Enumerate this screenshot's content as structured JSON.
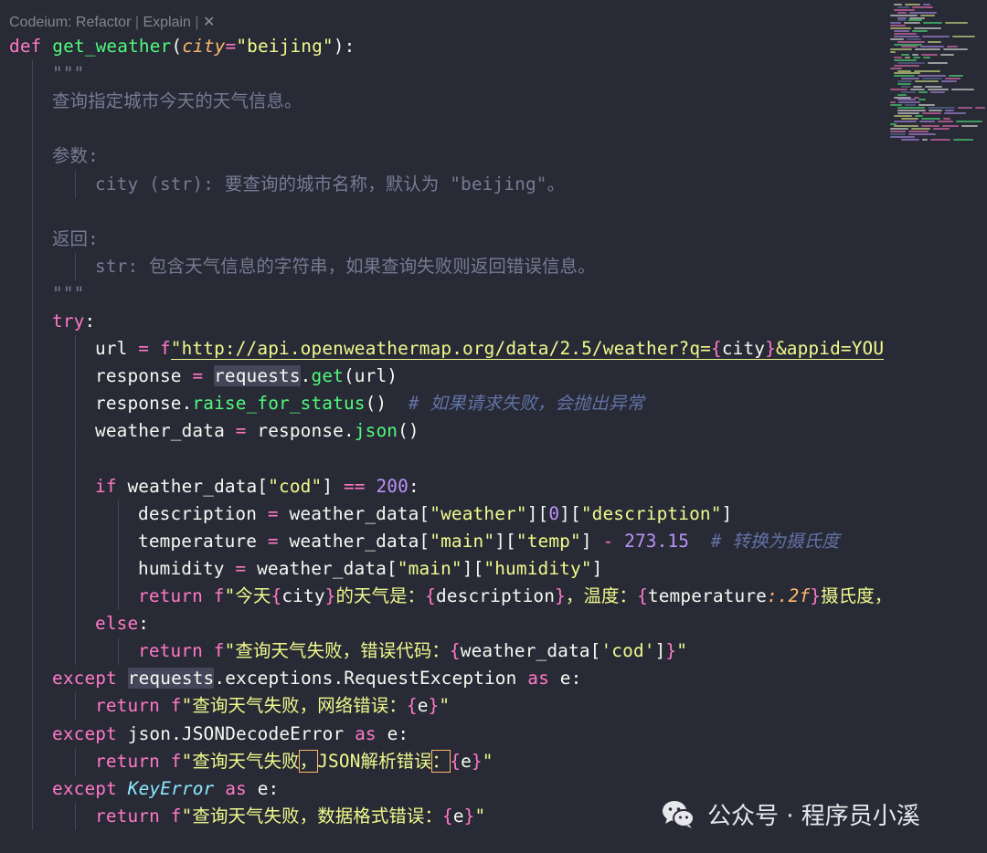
{
  "codelens": {
    "items": [
      "Codeium: Refactor",
      "Explain"
    ],
    "close_glyph": "✕"
  },
  "watermark": {
    "text": "公众号 · 程序员小溪"
  },
  "lines": [
    {
      "indent": 0,
      "tokens": [
        [
          "kw",
          "def "
        ],
        [
          "fn",
          "get_weather"
        ],
        [
          "txt",
          "("
        ],
        [
          "par",
          "city"
        ],
        [
          "op",
          "="
        ],
        [
          "str",
          "\"beijing\""
        ],
        [
          "txt",
          "):"
        ]
      ]
    },
    {
      "indent": 1,
      "tokens": [
        [
          "doc",
          "\"\"\""
        ]
      ]
    },
    {
      "indent": 1,
      "tokens": [
        [
          "doc",
          "查询指定城市今天的天气信息。"
        ]
      ]
    },
    {
      "indent": 1,
      "tokens": []
    },
    {
      "indent": 1,
      "tokens": [
        [
          "doc",
          "参数:"
        ]
      ]
    },
    {
      "indent": 2,
      "tokens": [
        [
          "doc",
          "city (str): 要查询的城市名称，默认为 \"beijing\"。"
        ]
      ]
    },
    {
      "indent": 1,
      "tokens": []
    },
    {
      "indent": 1,
      "tokens": [
        [
          "doc",
          "返回:"
        ]
      ]
    },
    {
      "indent": 2,
      "tokens": [
        [
          "doc",
          "str: 包含天气信息的字符串，如果查询失败则返回错误信息。"
        ]
      ]
    },
    {
      "indent": 1,
      "tokens": [
        [
          "doc",
          "\"\"\""
        ]
      ]
    },
    {
      "indent": 1,
      "tokens": [
        [
          "kw",
          "try"
        ],
        [
          "txt",
          ":"
        ]
      ]
    },
    {
      "indent": 2,
      "tokens": [
        [
          "txt",
          "url "
        ],
        [
          "op",
          "= "
        ],
        [
          "kw",
          "f"
        ],
        [
          "str|underline",
          "\"http://api.openweathermap.org/data/2.5/weather?q="
        ],
        [
          "br1|underline",
          "{"
        ],
        [
          "txt|underline",
          "city"
        ],
        [
          "br1|underline",
          "}"
        ],
        [
          "str|underline",
          "&appid=YOU"
        ]
      ]
    },
    {
      "indent": 2,
      "tokens": [
        [
          "txt",
          "response "
        ],
        [
          "op",
          "= "
        ],
        [
          "txt|hl",
          "requests"
        ],
        [
          "txt",
          "."
        ],
        [
          "attr",
          "get"
        ],
        [
          "txt",
          "(url)"
        ]
      ]
    },
    {
      "indent": 2,
      "tokens": [
        [
          "txt",
          "response."
        ],
        [
          "attr",
          "raise_for_status"
        ],
        [
          "txt",
          "()  "
        ],
        [
          "cmt",
          "# 如果请求失败，会抛出异常"
        ]
      ]
    },
    {
      "indent": 2,
      "tokens": [
        [
          "txt",
          "weather_data "
        ],
        [
          "op",
          "= "
        ],
        [
          "txt",
          "response."
        ],
        [
          "attr",
          "json"
        ],
        [
          "txt",
          "()"
        ]
      ]
    },
    {
      "indent": 2,
      "tokens": []
    },
    {
      "indent": 2,
      "tokens": [
        [
          "kw",
          "if "
        ],
        [
          "txt",
          "weather_data["
        ],
        [
          "str",
          "\"cod\""
        ],
        [
          "txt",
          "] "
        ],
        [
          "op",
          "== "
        ],
        [
          "num",
          "200"
        ],
        [
          "txt",
          ":"
        ]
      ]
    },
    {
      "indent": 3,
      "tokens": [
        [
          "txt",
          "description "
        ],
        [
          "op",
          "= "
        ],
        [
          "txt",
          "weather_data["
        ],
        [
          "str",
          "\"weather\""
        ],
        [
          "txt",
          "]["
        ],
        [
          "num",
          "0"
        ],
        [
          "txt",
          "]["
        ],
        [
          "str",
          "\"description\""
        ],
        [
          "txt",
          "]"
        ]
      ]
    },
    {
      "indent": 3,
      "tokens": [
        [
          "txt",
          "temperature "
        ],
        [
          "op",
          "= "
        ],
        [
          "txt",
          "weather_data["
        ],
        [
          "str",
          "\"main\""
        ],
        [
          "txt",
          "]["
        ],
        [
          "str",
          "\"temp\""
        ],
        [
          "txt",
          "] "
        ],
        [
          "op",
          "- "
        ],
        [
          "num",
          "273.15"
        ],
        [
          "txt",
          "  "
        ],
        [
          "cmt",
          "# 转换为摄氏度"
        ]
      ]
    },
    {
      "indent": 3,
      "tokens": [
        [
          "txt",
          "humidity "
        ],
        [
          "op",
          "= "
        ],
        [
          "txt",
          "weather_data["
        ],
        [
          "str",
          "\"main\""
        ],
        [
          "txt",
          "]["
        ],
        [
          "str",
          "\"humidity\""
        ],
        [
          "txt",
          "]"
        ]
      ]
    },
    {
      "indent": 3,
      "tokens": [
        [
          "kw",
          "return "
        ],
        [
          "kw",
          "f"
        ],
        [
          "str",
          "\"今天"
        ],
        [
          "br1",
          "{"
        ],
        [
          "txt",
          "city"
        ],
        [
          "br1",
          "}"
        ],
        [
          "str",
          "的天气是："
        ],
        [
          "br1",
          "{"
        ],
        [
          "txt",
          "description"
        ],
        [
          "br1",
          "}"
        ],
        [
          "str",
          "，温度："
        ],
        [
          "br1",
          "{"
        ],
        [
          "txt",
          "temperature"
        ],
        [
          "par",
          ":.2f"
        ],
        [
          "br1",
          "}"
        ],
        [
          "str",
          "摄氏度，"
        ]
      ]
    },
    {
      "indent": 2,
      "tokens": [
        [
          "kw",
          "else"
        ],
        [
          "txt",
          ":"
        ]
      ]
    },
    {
      "indent": 3,
      "tokens": [
        [
          "kw",
          "return "
        ],
        [
          "kw",
          "f"
        ],
        [
          "str",
          "\"查询天气失败，错误代码："
        ],
        [
          "br1",
          "{"
        ],
        [
          "txt",
          "weather_data["
        ],
        [
          "str",
          "'cod'"
        ],
        [
          "txt",
          "]"
        ],
        [
          "br1",
          "}"
        ],
        [
          "str",
          "\""
        ]
      ]
    },
    {
      "indent": 1,
      "tokens": [
        [
          "kw",
          "except "
        ],
        [
          "txt|hl",
          "requests"
        ],
        [
          "txt",
          ".exceptions.RequestException "
        ],
        [
          "kw",
          "as "
        ],
        [
          "txt",
          "e:"
        ]
      ]
    },
    {
      "indent": 2,
      "tokens": [
        [
          "kw",
          "return "
        ],
        [
          "kw",
          "f"
        ],
        [
          "str",
          "\"查询天气失败，网络错误："
        ],
        [
          "br1",
          "{"
        ],
        [
          "txt",
          "e"
        ],
        [
          "br1",
          "}"
        ],
        [
          "str",
          "\""
        ]
      ]
    },
    {
      "indent": 1,
      "tokens": [
        [
          "kw",
          "except "
        ],
        [
          "txt",
          "json.JSONDecodeError "
        ],
        [
          "kw",
          "as "
        ],
        [
          "txt",
          "e:"
        ]
      ]
    },
    {
      "indent": 2,
      "tokens": [
        [
          "kw",
          "return "
        ],
        [
          "kw",
          "f"
        ],
        [
          "str",
          "\"查询天气失败"
        ],
        [
          "str|box",
          "，"
        ],
        [
          "str",
          "JSON解析错误"
        ],
        [
          "str|box",
          "："
        ],
        [
          "br1",
          "{"
        ],
        [
          "txt",
          "e"
        ],
        [
          "br1",
          "}"
        ],
        [
          "str",
          "\""
        ]
      ]
    },
    {
      "indent": 1,
      "tokens": [
        [
          "kw",
          "except "
        ],
        [
          "cls",
          "KeyError "
        ],
        [
          "kw",
          "as "
        ],
        [
          "txt",
          "e:"
        ]
      ]
    },
    {
      "indent": 2,
      "tokens": [
        [
          "kw",
          "return "
        ],
        [
          "kw",
          "f"
        ],
        [
          "str",
          "\"查询天气失败，数据格式错误："
        ],
        [
          "br1",
          "{"
        ],
        [
          "txt",
          "e"
        ],
        [
          "br1",
          "}"
        ],
        [
          "str",
          "\""
        ]
      ]
    }
  ]
}
